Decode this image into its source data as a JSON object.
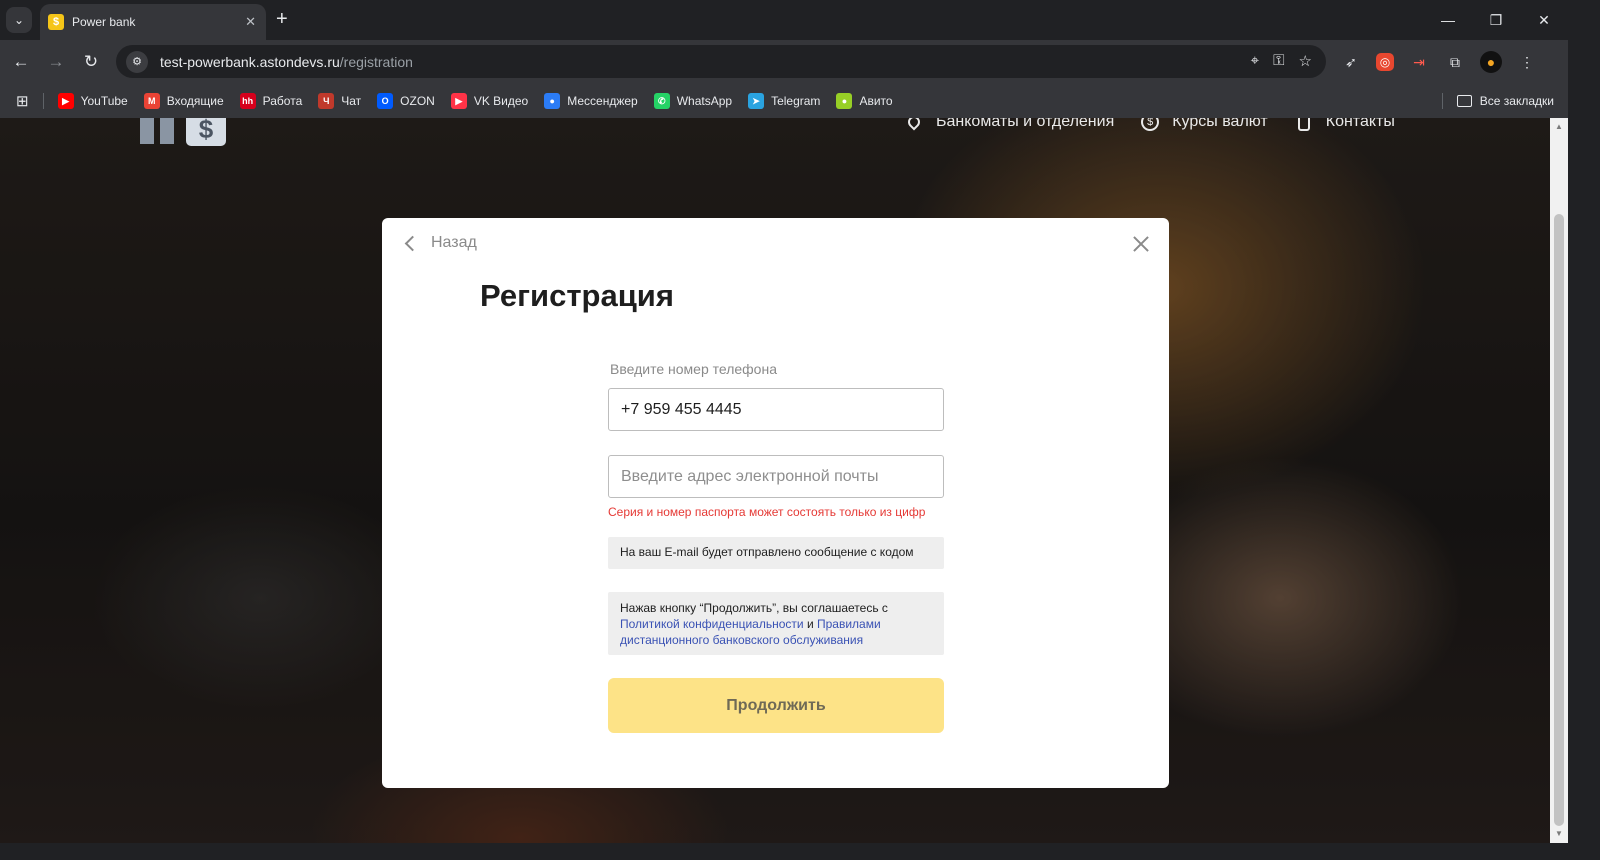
{
  "browser": {
    "tab": {
      "title": "Power bank",
      "favicon_icon": "dollar-badge-icon",
      "favicon_color": "#f5c518"
    },
    "url": {
      "domain": "test-powerbank.astondevs.ru",
      "path": "/registration"
    },
    "bookmarks": [
      {
        "label": "YouTube",
        "icon": "youtube-icon",
        "color": "#ff0000",
        "glyph": "▶"
      },
      {
        "label": "Входящие",
        "icon": "gmail-icon",
        "color": "#ea4335",
        "glyph": "M"
      },
      {
        "label": "Работа",
        "icon": "hh-icon",
        "color": "#d6001c",
        "glyph": "hh"
      },
      {
        "label": "Чат",
        "icon": "chat-icon",
        "color": "#c0392b",
        "glyph": "Ч"
      },
      {
        "label": "OZON",
        "icon": "ozon-icon",
        "color": "#005bff",
        "glyph": "O"
      },
      {
        "label": "VK Видео",
        "icon": "vk-video-icon",
        "color": "#ff3347",
        "glyph": "▶"
      },
      {
        "label": "Мессенджер",
        "icon": "messenger-icon",
        "color": "#2b7cf6",
        "glyph": "●"
      },
      {
        "label": "WhatsApp",
        "icon": "whatsapp-icon",
        "color": "#25d366",
        "glyph": "✆"
      },
      {
        "label": "Telegram",
        "icon": "telegram-icon",
        "color": "#2aa3e0",
        "glyph": "➤"
      },
      {
        "label": "Авито",
        "icon": "avito-icon",
        "color": "#97cf26",
        "glyph": "●"
      }
    ],
    "all_bookmarks_label": "Все закладки"
  },
  "site": {
    "nav": [
      {
        "label": "Банкоматы и отделения",
        "icon": "map-pin-icon"
      },
      {
        "label": "Курсы валют",
        "icon": "currency-icon"
      },
      {
        "label": "Контакты",
        "icon": "phone-icon"
      }
    ],
    "logo_glyph": "$"
  },
  "modal": {
    "back_label": "Назад",
    "title": "Регистрация",
    "phone_label": "Введите номер телефона",
    "phone_value": "+7 959 455 4445",
    "email_placeholder": "Введите адрес электронной почты",
    "email_value": "",
    "error_text": "Серия и номер паспорта может состоять только из цифр",
    "info_text": "На ваш E-mail будет отправлено сообщение с кодом",
    "consent_prefix": "Нажав кнопку “Продолжить”, вы соглашаетесь с",
    "privacy_link": "Политикой конфиденциальности",
    "consent_and": "и",
    "rules_link": "Правилами дистанционного банковского обслуживания",
    "continue_label": "Продолжить"
  }
}
